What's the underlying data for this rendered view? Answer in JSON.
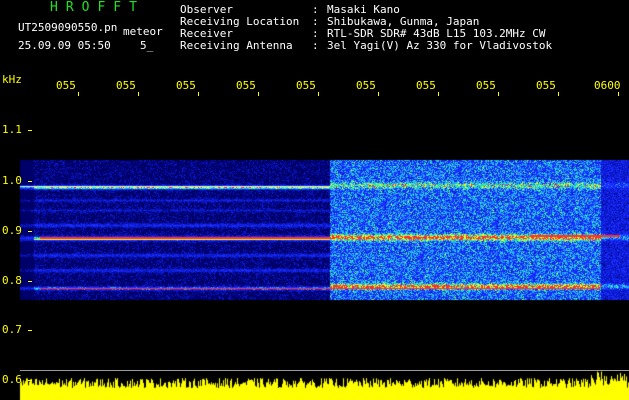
{
  "header": {
    "app_title": "HROFFT",
    "file_name": "UT2509090550.pn",
    "mode": "meteor",
    "timestamp": "25.09.09 05:50",
    "timestamp_suffix": "5_"
  },
  "station_info": [
    {
      "label": "Observer",
      "value": "Masaki Kano"
    },
    {
      "label": "Receiving Location",
      "value": "Shibukawa, Gunma, Japan"
    },
    {
      "label": "Receiver",
      "value": "RTL-SDR SDR# 43dB L15 103.2MHz CW"
    },
    {
      "label": "Receiving Antenna",
      "value": "3el Yagi(V) Az 330 for Vladivostok"
    }
  ],
  "separator": ":",
  "frequency_axis": {
    "unit": "kHz",
    "ticks": [
      {
        "label": "1.1",
        "value": 1.1
      },
      {
        "label": "1.0",
        "value": 1.0
      },
      {
        "label": "0.9",
        "value": 0.9
      },
      {
        "label": "0.8",
        "value": 0.8
      },
      {
        "label": "0.7",
        "value": 0.7
      },
      {
        "label": "0.6",
        "value": 0.6
      }
    ]
  },
  "time_axis": {
    "ticks": [
      "055",
      "055",
      "055",
      "055",
      "055",
      "055",
      "055",
      "055",
      "055",
      "0600"
    ]
  },
  "colors": {
    "text_white": "#ffffff",
    "title_green": "#22e022",
    "axis_yellow": "#ffff00",
    "signal_band_blue": "#1a2cff",
    "signal_hot_red": "#ff2a2a"
  }
}
